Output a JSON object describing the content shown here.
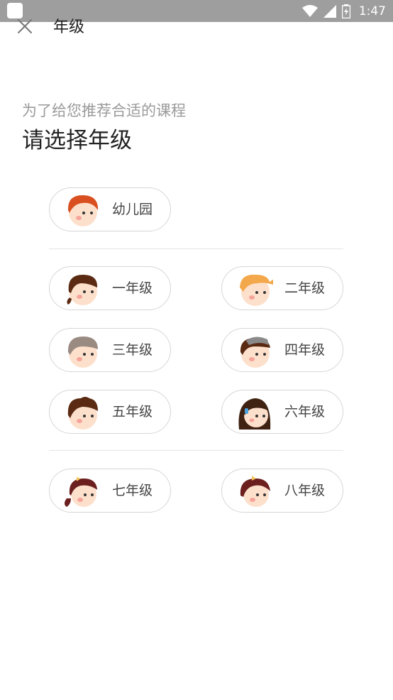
{
  "status_bar": {
    "time": "1:47"
  },
  "header": {
    "title": "年级"
  },
  "intro": {
    "subtitle": "为了给您推荐合适的课程",
    "headline": "请选择年级"
  },
  "grades": {
    "kindergarten": {
      "label": "幼儿园"
    },
    "grade1": {
      "label": "一年级"
    },
    "grade2": {
      "label": "二年级"
    },
    "grade3": {
      "label": "三年级"
    },
    "grade4": {
      "label": "四年级"
    },
    "grade5": {
      "label": "五年级"
    },
    "grade6": {
      "label": "六年级"
    },
    "grade7": {
      "label": "七年级"
    },
    "grade8": {
      "label": "八年级"
    }
  },
  "icons": {
    "close": "close-icon",
    "wifi": "wifi-icon",
    "signal": "signal-icon",
    "battery": "battery-charging-icon"
  },
  "colors": {
    "status_bar": "#9e9e9e",
    "pill_border": "#d6d6d6",
    "subtitle": "#9a9a9a",
    "skin": "#fde0cc",
    "cheek": "#f6a39a"
  }
}
